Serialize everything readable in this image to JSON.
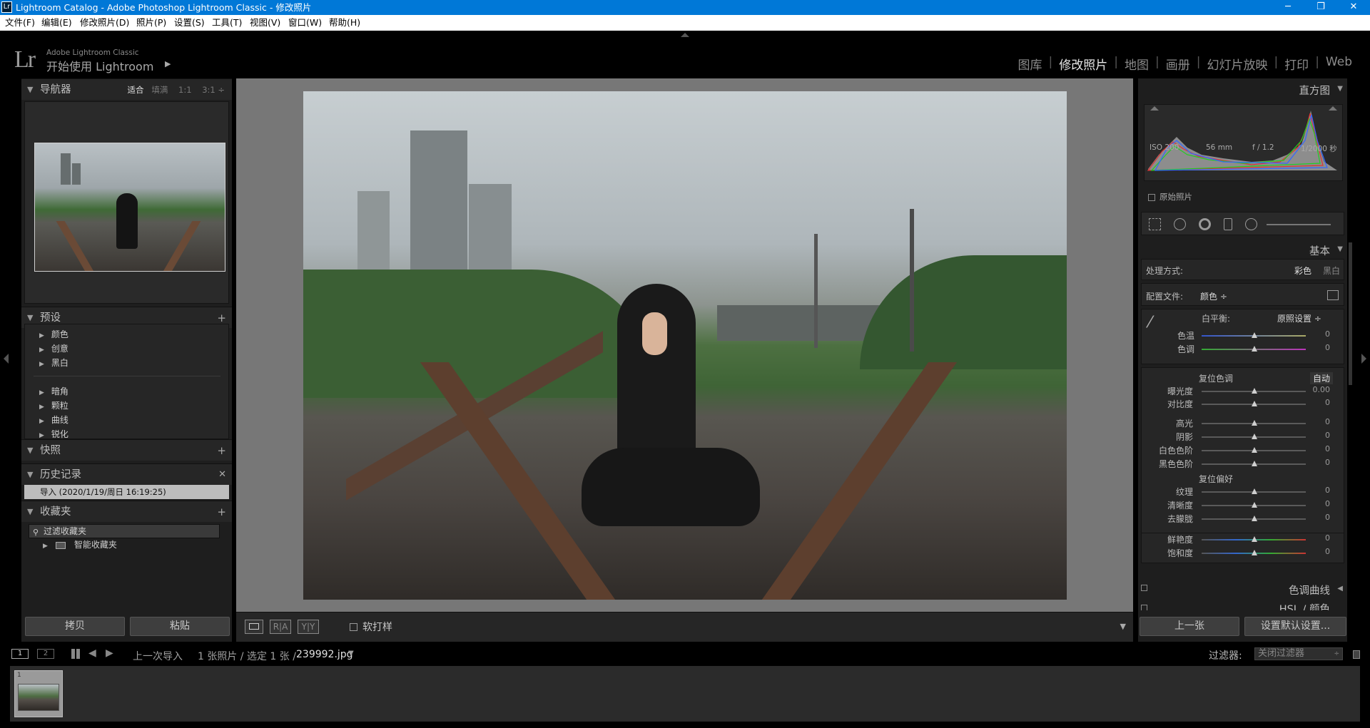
{
  "window": {
    "title": "Lightroom Catalog - Adobe Photoshop Lightroom Classic - 修改照片",
    "app_icon": "Lr",
    "minimize": "─",
    "maximize": "❐",
    "close": "✕"
  },
  "menu": [
    "文件(F)",
    "编辑(E)",
    "修改照片(D)",
    "照片(P)",
    "设置(S)",
    "工具(T)",
    "视图(V)",
    "窗口(W)",
    "帮助(H)"
  ],
  "identity": {
    "logo": "Lr",
    "brand": "Adobe Lightroom Classic",
    "getting_started": "开始使用 Lightroom",
    "arrow": "▶"
  },
  "modules": {
    "items": [
      "图库",
      "修改照片",
      "地图",
      "画册",
      "幻灯片放映",
      "打印",
      "Web"
    ],
    "active": "修改照片"
  },
  "left": {
    "navigator": {
      "label": "导航器",
      "fit": "适合",
      "fill": "填满",
      "one": "1:1",
      "three": "3:1"
    },
    "presets": {
      "label": "预设",
      "groups1": [
        "颜色",
        "创意",
        "黑白"
      ],
      "groups2": [
        "暗角",
        "颗粒",
        "曲线",
        "锐化"
      ]
    },
    "snapshots": {
      "label": "快照"
    },
    "history": {
      "label": "历史记录",
      "entry": "导入 (2020/1/19/周日 16:19:25)"
    },
    "collections": {
      "label": "收藏夹",
      "filter": "过滤收藏夹",
      "smart": "智能收藏夹"
    },
    "copy_btn": "拷贝",
    "paste_btn": "粘贴"
  },
  "toolbar": {
    "softproof": "软打样"
  },
  "right": {
    "histogram": {
      "label": "直方图",
      "iso": "ISO 200",
      "focal": "56 mm",
      "aperture": "f / 1.2",
      "shutter": "1/2000 秒",
      "original": "原始照片"
    },
    "basic": {
      "label": "基本",
      "treatment": "处理方式:",
      "color": "彩色",
      "bw": "黑白",
      "profile_label": "配置文件:",
      "profile": "颜色 ÷",
      "wb_label": "白平衡:",
      "wb_value": "原照设置 ÷",
      "temp": "色温",
      "temp_v": "0",
      "tint": "色调",
      "tint_v": "0",
      "tone_label": "复位色调",
      "auto": "自动",
      "exposure": "曝光度",
      "exposure_v": "0.00",
      "contrast": "对比度",
      "contrast_v": "0",
      "highlights": "高光",
      "highlights_v": "0",
      "shadows": "阴影",
      "shadows_v": "0",
      "whites": "白色色阶",
      "whites_v": "0",
      "blacks": "黑色色阶",
      "blacks_v": "0",
      "presence_label": "复位偏好",
      "texture": "纹理",
      "texture_v": "0",
      "clarity": "清晰度",
      "clarity_v": "0",
      "dehaze": "去朦胧",
      "dehaze_v": "0",
      "vibrance": "鲜艳度",
      "vibrance_v": "0",
      "saturation": "饱和度",
      "saturation_v": "0"
    },
    "tone_curve": {
      "label": "色调曲线"
    },
    "hsl": {
      "label": "HSL / 颜色"
    },
    "prev_btn": "上一张",
    "reset_btn": "设置默认设置..."
  },
  "filmstrip": {
    "page1": "1",
    "page2": "2",
    "source": "上一次导入",
    "count": "1 张照片 / 选定 1 张 /",
    "filename": "239992.jpg",
    "filter_label": "过滤器:",
    "filter_value": "关闭过滤器",
    "thumb_index": "1"
  }
}
